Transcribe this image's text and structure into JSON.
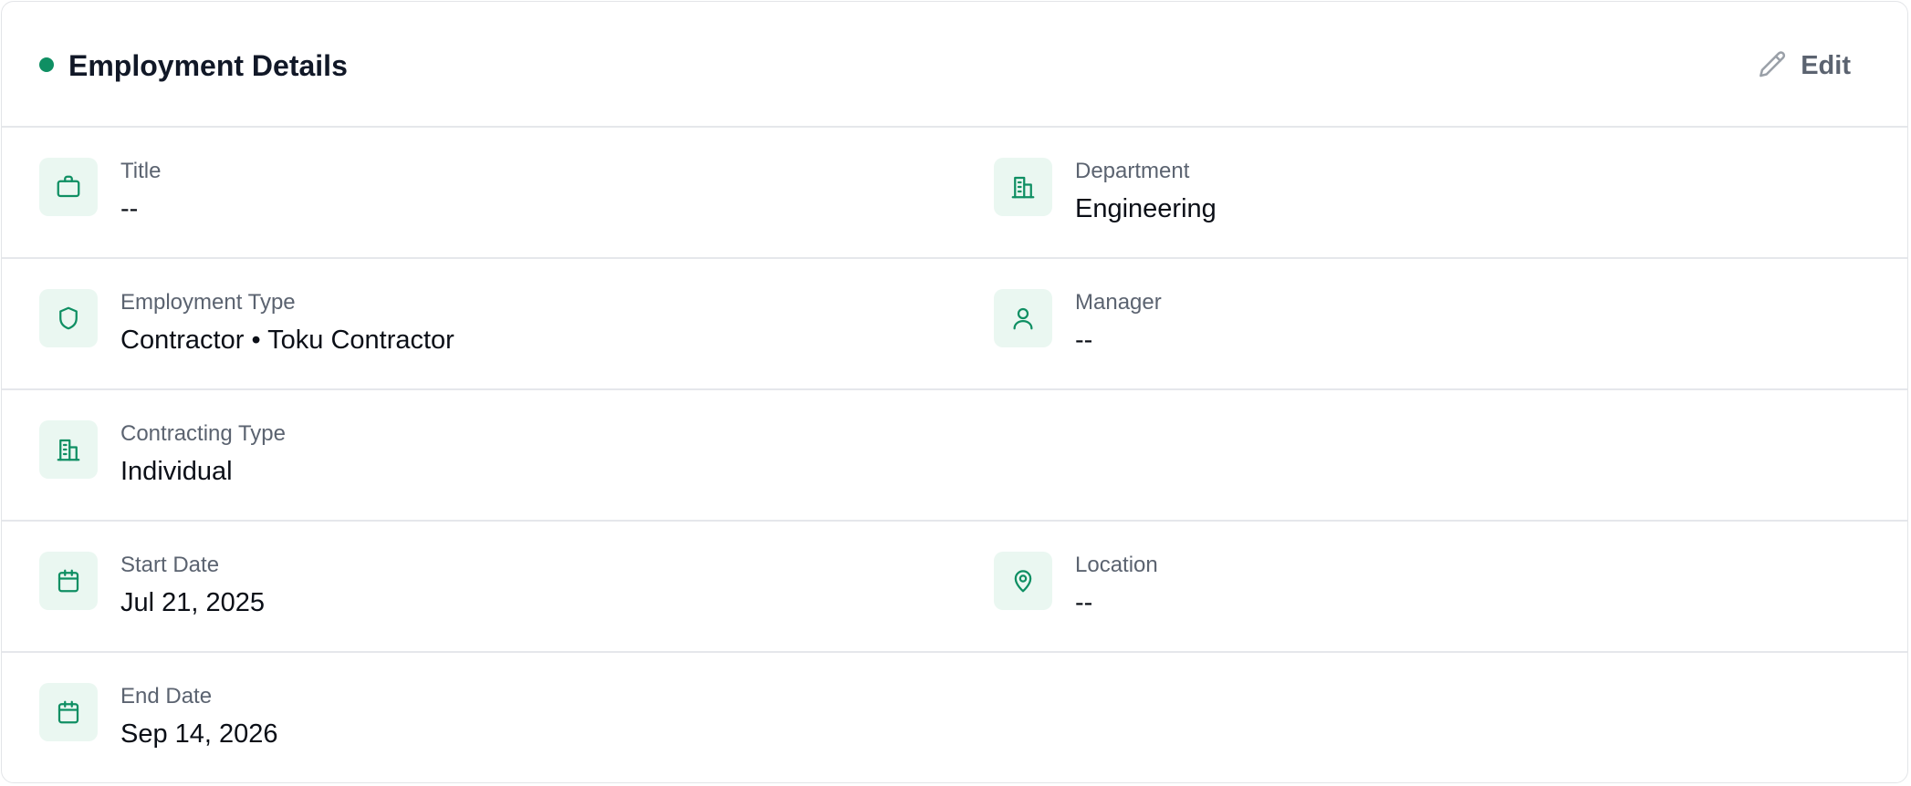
{
  "header": {
    "title": "Employment Details",
    "edit_label": "Edit",
    "status_color": "#0f8f63"
  },
  "fields": {
    "title": {
      "label": "Title",
      "value": "--",
      "icon": "briefcase-icon"
    },
    "department": {
      "label": "Department",
      "value": "Engineering",
      "icon": "building-icon"
    },
    "employment_type": {
      "label": "Employment Type",
      "value": "Contractor • Toku Contractor",
      "icon": "shield-icon"
    },
    "manager": {
      "label": "Manager",
      "value": "--",
      "icon": "user-icon"
    },
    "contracting_type": {
      "label": "Contracting Type",
      "value": "Individual",
      "icon": "building-icon"
    },
    "start_date": {
      "label": "Start Date",
      "value": "Jul 21, 2025",
      "icon": "calendar-icon"
    },
    "location": {
      "label": "Location",
      "value": "--",
      "icon": "map-pin-icon"
    },
    "end_date": {
      "label": "End Date",
      "value": "Sep 14, 2026",
      "icon": "calendar-icon"
    }
  },
  "colors": {
    "accent": "#0f8f63",
    "icon_bg": "#eaf7f1",
    "label": "#5b6370",
    "value": "#0b0f17",
    "divider": "#e5e7eb"
  }
}
